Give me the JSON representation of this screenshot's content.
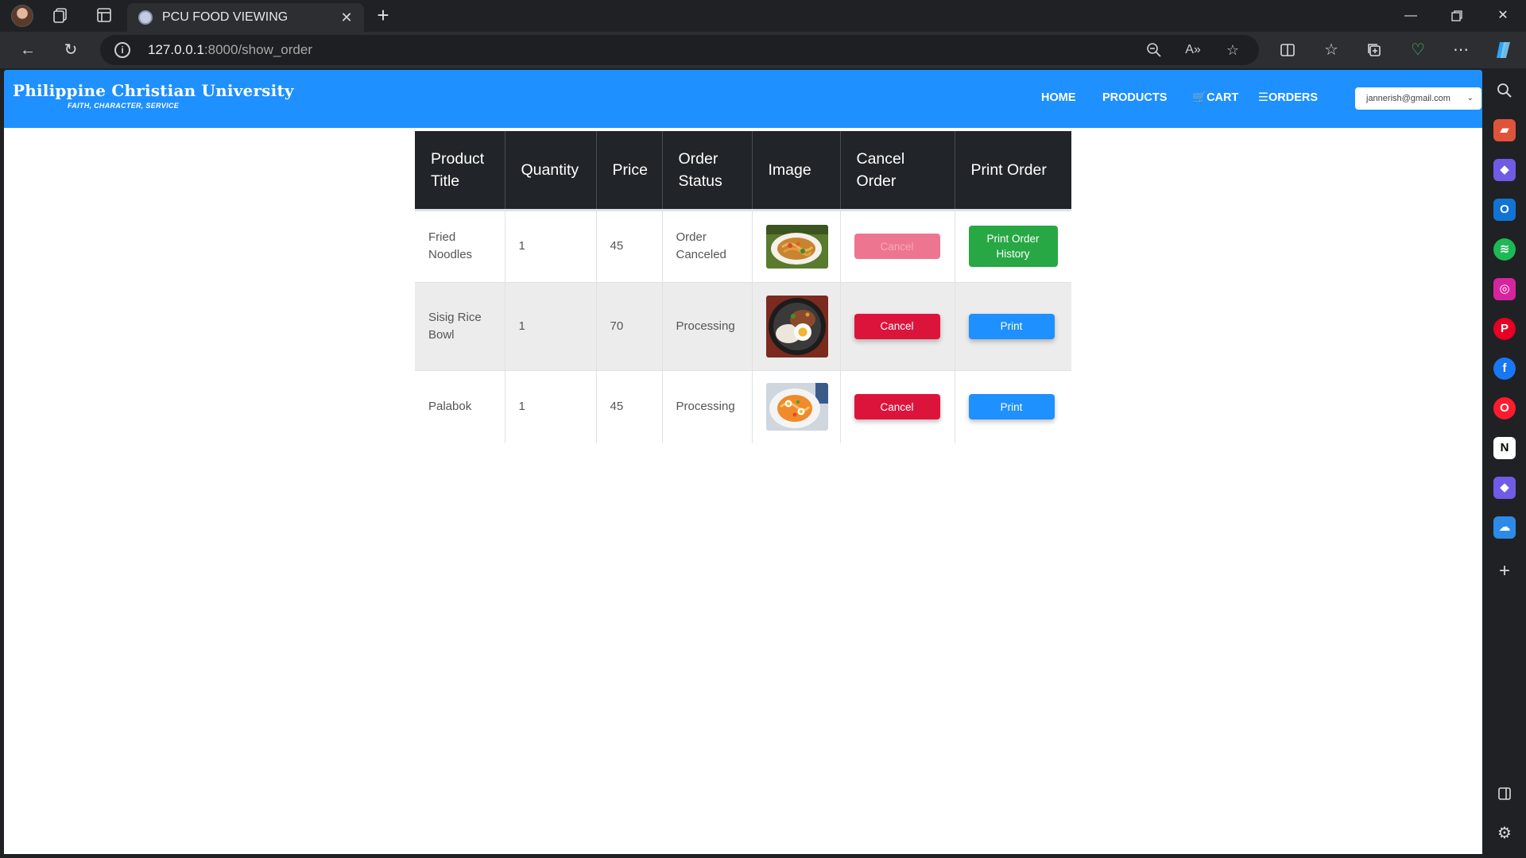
{
  "browser": {
    "tab_title": "PCU FOOD VIEWING",
    "url_host": "127.0.0.1",
    "url_path": ":8000/show_order",
    "icons": [
      "profile-avatar",
      "workspaces-icon",
      "tab-actions-icon",
      "refresh-icon",
      "back-icon",
      "zoom-icon",
      "read-aloud-icon",
      "favorite-star-icon",
      "split-screen-icon",
      "favorites-icon",
      "collections-icon",
      "browser-essentials-icon",
      "more-icon",
      "copilot-icon"
    ]
  },
  "sidebar": {
    "icons": [
      "search-icon",
      "tools-icon",
      "copilot-app-icon",
      "outlook-icon",
      "spotify-icon",
      "instagram-icon",
      "pinterest-icon",
      "facebook-icon",
      "opera-icon",
      "notion-icon",
      "copilot-app-icon-2",
      "onedrive-icon",
      "add-icon",
      "sidebar-toggle-icon",
      "settings-icon"
    ]
  },
  "site": {
    "logo_title": "Philippine Christian University",
    "logo_tagline": "FAITH, CHARACTER, SERVICE",
    "nav": {
      "home": "HOME",
      "products": "PRODUCTS",
      "cart": "CART",
      "orders": "ORDERS"
    },
    "user_email": "jannerish@gmail.com",
    "brand_color": "#1e90ff"
  },
  "table": {
    "headers": {
      "product_title": "Product Title",
      "quantity": "Quantity",
      "price": "Price",
      "order_status": "Order Status",
      "image": "Image",
      "cancel_order": "Cancel Order",
      "print_order": "Print Order"
    },
    "rows": [
      {
        "title": "Fried Noodles",
        "quantity": "1",
        "price": "45",
        "status": "Order Canceled",
        "image": "fried-noodles",
        "cancel_label": "Cancel",
        "cancel_disabled": true,
        "print_label": "Print Order History"
      },
      {
        "title": "Sisig Rice Bowl",
        "quantity": "1",
        "price": "70",
        "status": "Processing",
        "image": "sisig-rice-bowl",
        "cancel_label": "Cancel",
        "cancel_disabled": false,
        "print_label": "Print"
      },
      {
        "title": "Palabok",
        "quantity": "1",
        "price": "45",
        "status": "Processing",
        "image": "palabok",
        "cancel_label": "Cancel",
        "cancel_disabled": false,
        "print_label": "Print"
      }
    ]
  }
}
